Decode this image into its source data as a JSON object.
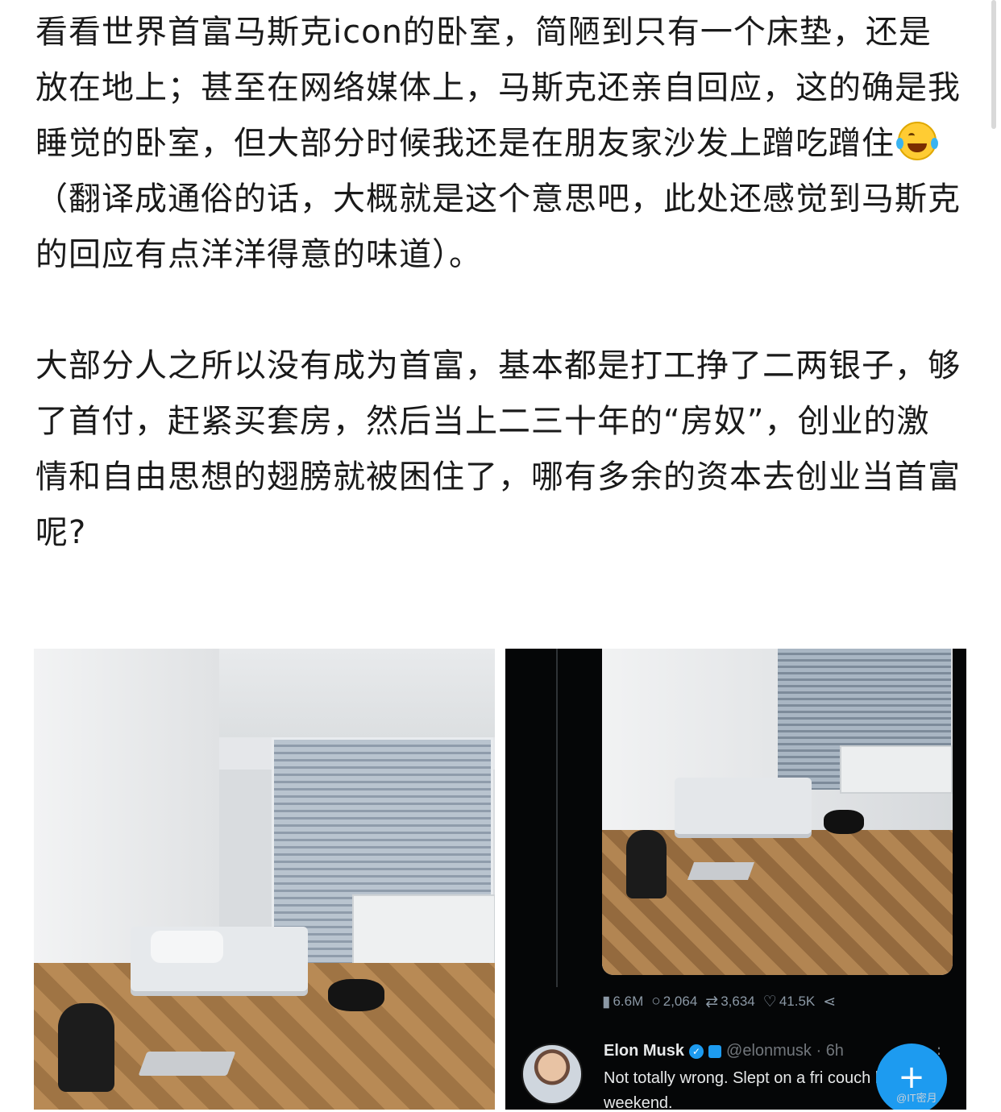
{
  "post": {
    "paragraph1_a": "看看世界首富马斯克icon的卧室，简陋到只有一个床垫，还是放在地上；甚至在网络媒体上，马斯克还亲自回应，这的确是我睡觉的卧室，但大部分时候我还是在朋友家沙发上蹭吃蹭住",
    "emoji": "laughing-crying-emoji",
    "paragraph1_b": "（翻译成通俗的话，大概就是这个意思吧，此处还感觉到马斯克的回应有点洋洋得意的味道）。",
    "paragraph2": "大部分人之所以没有成为首富，基本都是打工挣了二两银子，够了首付，赶紧买套房，然后当上二三十年的“房奴”，创业的激情和自由思想的翅膀就被困住了，哪有多余的资本去创业当首富呢?"
  },
  "tweet": {
    "views": "6.6M",
    "replies": "2,064",
    "retweets": "3,634",
    "likes": "41.5K",
    "name": "Elon Musk",
    "handle": "@elonmusk · 6h",
    "text": "Not totally wrong. Slept on a fri couch last weekend.",
    "fab": "+",
    "watermark": "@IT密月"
  },
  "colors": {
    "accent": "#1d9bf0",
    "tweet_bg": "#050607",
    "text": "#1a1a1a"
  }
}
